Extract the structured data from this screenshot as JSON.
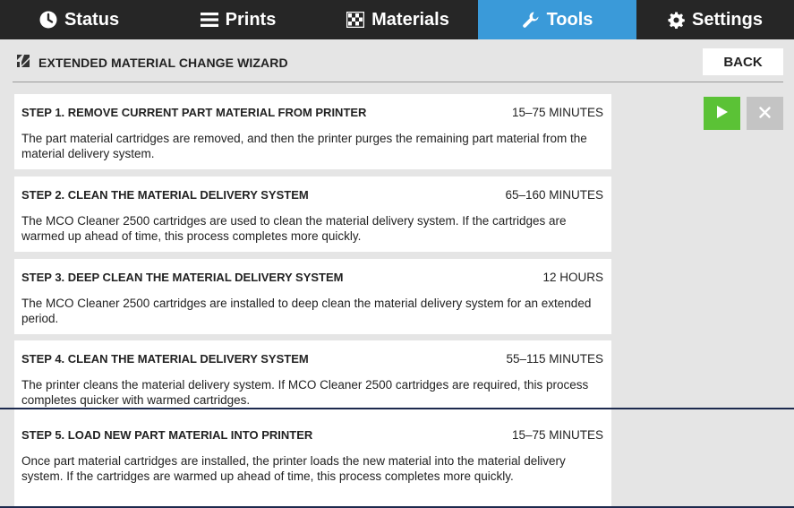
{
  "nav": {
    "tabs": [
      {
        "label": "Status",
        "icon": "clock-icon",
        "active": false
      },
      {
        "label": "Prints",
        "icon": "list-icon",
        "active": false
      },
      {
        "label": "Materials",
        "icon": "checkered-icon",
        "active": false
      },
      {
        "label": "Tools",
        "icon": "wrench-icon",
        "active": true
      },
      {
        "label": "Settings",
        "icon": "gear-icon",
        "active": false
      }
    ]
  },
  "header": {
    "title": "EXTENDED MATERIAL CHANGE WIZARD",
    "back_label": "BACK"
  },
  "steps": [
    {
      "title": "STEP 1. REMOVE CURRENT PART MATERIAL FROM PRINTER",
      "time": "15–75 MINUTES",
      "desc": "The part material cartridges are removed, and then the printer purges the remaining part material from the material delivery system."
    },
    {
      "title": "STEP 2. CLEAN THE MATERIAL DELIVERY SYSTEM",
      "time": "65–160 MINUTES",
      "desc": "The MCO Cleaner 2500 cartridges are used to clean the material delivery system. If the cartridges are warmed up ahead of time, this process completes more quickly."
    },
    {
      "title": "STEP 3. DEEP CLEAN THE MATERIAL DELIVERY SYSTEM",
      "time": "12 HOURS",
      "desc": "The MCO Cleaner 2500 cartridges are installed to deep clean the material delivery system for an extended period."
    },
    {
      "title": "STEP 4. CLEAN THE MATERIAL DELIVERY SYSTEM",
      "time": "55–115 MINUTES",
      "desc": "The printer cleans the material delivery system. If MCO Cleaner 2500 cartridges are required, this process completes quicker with warmed cartridges."
    },
    {
      "title": "STEP 5. LOAD NEW PART MATERIAL INTO PRINTER",
      "time": "15–75 MINUTES",
      "desc": "Once part material cartridges are installed, the printer loads the new material into the material delivery system. If the cartridges are warmed up ahead of time, this process completes more quickly."
    }
  ],
  "colors": {
    "nav_bg": "#262626",
    "active_tab": "#3a9ad9",
    "play": "#5bc236",
    "close_disabled": "#c4c4c4",
    "page_bg": "#e5e5e5"
  }
}
